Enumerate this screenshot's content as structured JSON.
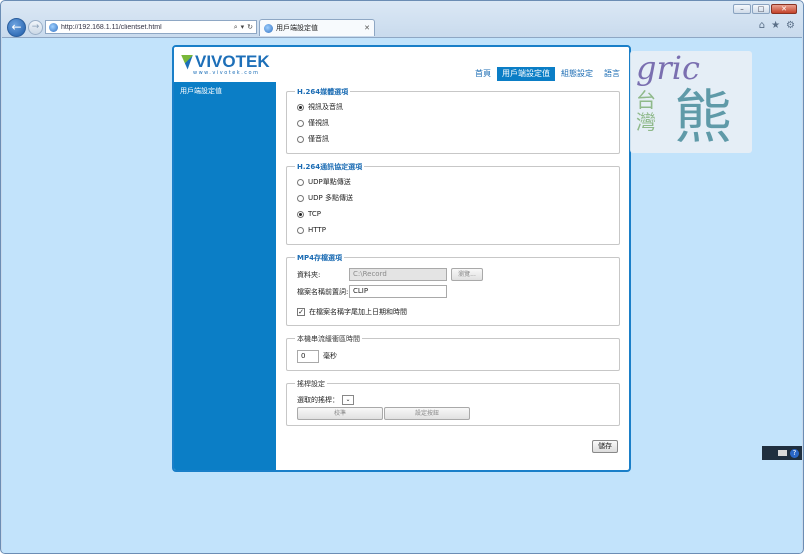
{
  "browser": {
    "address": "http://192.168.1.11/clientset.html",
    "tab_title": "用戶端設定值",
    "window_controls": [
      "–",
      "□",
      "✕"
    ],
    "tab_close": "✕",
    "back_glyph": "←",
    "forward_glyph": "→",
    "addr_tools": [
      "⌕",
      "▾",
      "↻"
    ],
    "right_icons": [
      "⌂",
      "★",
      "⚙"
    ]
  },
  "logo": {
    "brand": "VIVOTEK",
    "url": "www.vivotek.com"
  },
  "top_nav": [
    {
      "label": "首頁",
      "active": false
    },
    {
      "label": "用戶端設定值",
      "active": true
    },
    {
      "label": "組態設定",
      "active": false
    },
    {
      "label": "語言",
      "active": false
    }
  ],
  "sidebar": {
    "title": "用戶端設定值"
  },
  "h264_media": {
    "legend": "H.264媒體選項",
    "options": [
      "視訊及音訊",
      "僅視訊",
      "僅音訊"
    ],
    "selected": 0
  },
  "h264_protocol": {
    "legend": "H.264通訊協定選項",
    "options": [
      "UDP單點傳送",
      "UDP 多點傳送",
      "TCP",
      "HTTP"
    ],
    "selected": 2
  },
  "mp4": {
    "legend": "MP4存檔選項",
    "folder_label": "資料夾:",
    "folder_value": "C:\\Record",
    "browse_label": "瀏覽...",
    "prefix_label": "檔案名稱前置詞:",
    "prefix_value": "CLIP",
    "append_label": "在檔案名稱字尾加上日期和時間",
    "append_checked": true,
    "check_glyph": "✓"
  },
  "buffer": {
    "legend": "本機串流緩衝區時間",
    "value": "0",
    "unit": "毫秒"
  },
  "joystick": {
    "legend": "搖桿設定",
    "select_label": "選取的搖桿：",
    "select_glyph": "⌄",
    "calibrate_label": "校準",
    "buttons_label": "設定按鈕"
  },
  "save_label": "儲存",
  "watermark": {
    "script": "gric",
    "chars_line1": "台",
    "chars_line2": "灣",
    "big_char": "熊"
  },
  "tray": {
    "help_glyph": "?"
  }
}
